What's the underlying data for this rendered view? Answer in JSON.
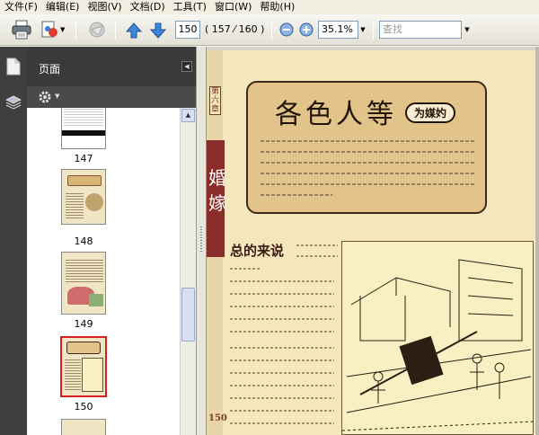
{
  "menu": {
    "items": [
      "文件(F)",
      "编辑(E)",
      "视图(V)",
      "文档(D)",
      "工具(T)",
      "窗口(W)",
      "帮助(H)"
    ]
  },
  "toolbar": {
    "icons": [
      "print-icon",
      "acrobat-share-icon",
      "send-disabled-icon",
      "prev-page-icon",
      "next-page-icon",
      "zoom-out-icon",
      "zoom-in-icon"
    ],
    "page_number": "150",
    "page_total": "( 157 ⁄ 160 )",
    "zoom_value": "35.1%",
    "search_placeholder": "查找"
  },
  "side_panel": {
    "title": "页面",
    "thumbnails": [
      {
        "label": "147",
        "selected": false
      },
      {
        "label": "148",
        "selected": false
      },
      {
        "label": "149",
        "selected": false
      },
      {
        "label": "150",
        "selected": true
      }
    ]
  },
  "document": {
    "page_title": "各色人等",
    "title_tag": "为媒妁",
    "chapter_tag": "第六章",
    "side_chars": "婚嫁",
    "section_heading": "总的来说",
    "page_number_label": "150"
  },
  "colors": {
    "panel_dark": "#3a3a3a",
    "selected_border": "#d42020",
    "page_paper": "#f4e6bd",
    "title_box": "#e2c48a",
    "chapter_red": "#8a2c2a"
  }
}
